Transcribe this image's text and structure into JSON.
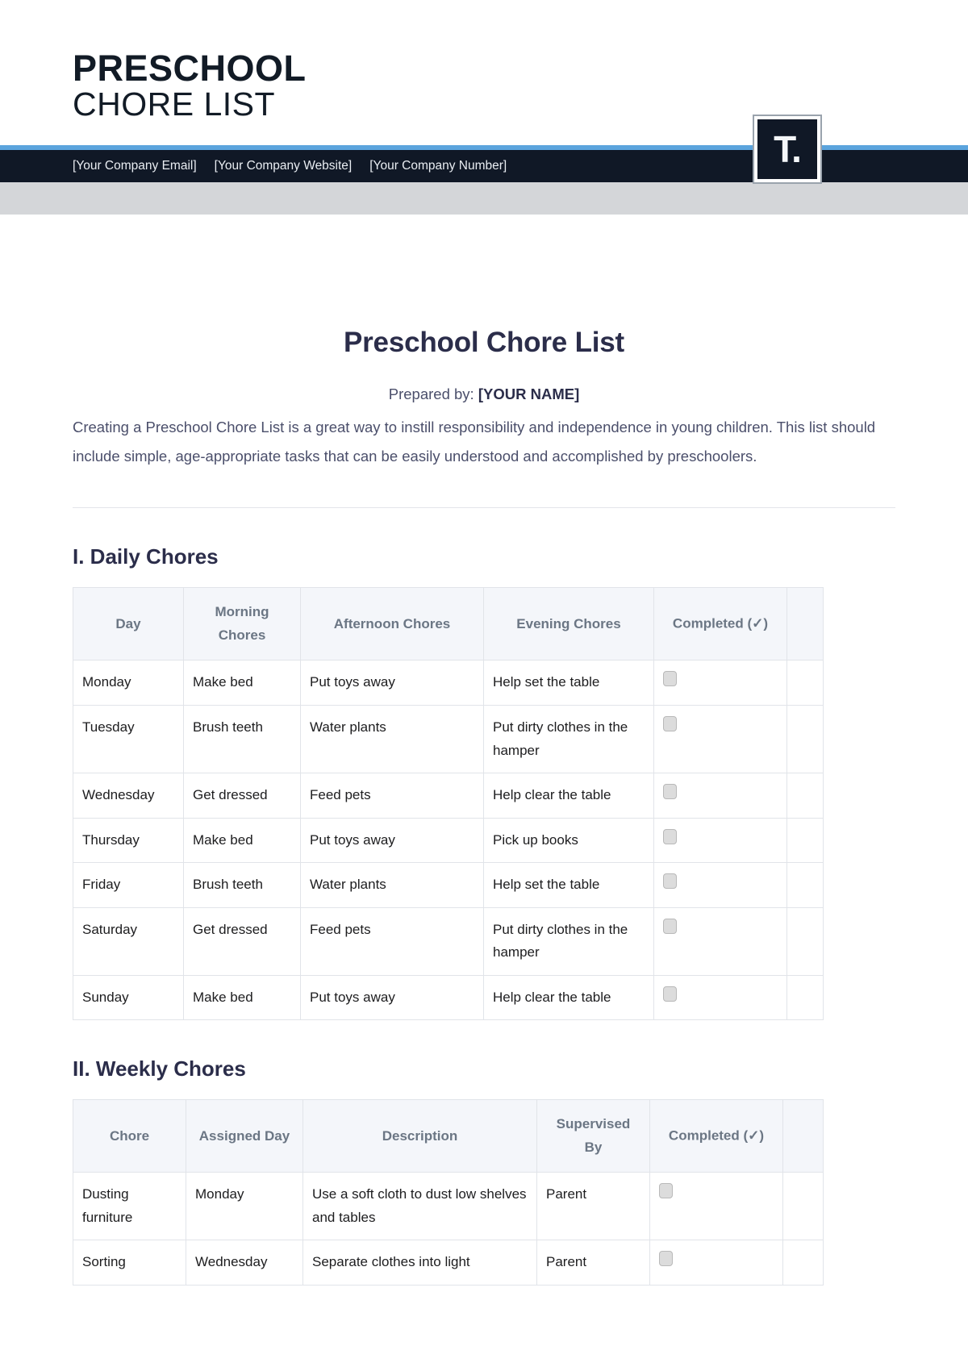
{
  "letterhead": {
    "brand_line1": "PRESCHOOL",
    "brand_line2": "CHORE LIST",
    "logo_glyph": "T.",
    "contacts": [
      "[Your Company Email]",
      "[Your Company Website]",
      "[Your Company Number]"
    ],
    "accent_blue": "#5ba4dd",
    "bar_dark": "#101826",
    "band_gray": "#d4d6d9"
  },
  "document": {
    "title": "Preschool Chore List",
    "prepared_label": "Prepared by:",
    "prepared_name": "[YOUR NAME]",
    "intro": "Creating a Preschool Chore List is a great way to instill responsibility and independence in young children. This list should include simple, age-appropriate tasks that can be easily understood and accomplished by preschoolers."
  },
  "sections": [
    {
      "heading": "I. Daily Chores",
      "columns": [
        "Day",
        "Morning Chores",
        "Afternoon Chores",
        "Evening Chores",
        "Completed (✓)",
        ""
      ],
      "rows": [
        [
          "Monday",
          "Make bed",
          "Put toys away",
          "Help set the table",
          "",
          ""
        ],
        [
          "Tuesday",
          "Brush teeth",
          "Water plants",
          "Put dirty clothes in the hamper",
          "",
          ""
        ],
        [
          "Wednesday",
          "Get dressed",
          "Feed pets",
          "Help clear the table",
          "",
          ""
        ],
        [
          "Thursday",
          "Make bed",
          "Put toys away",
          "Pick up books",
          "",
          ""
        ],
        [
          "Friday",
          "Brush teeth",
          "Water plants",
          "Help set the table",
          "",
          ""
        ],
        [
          "Saturday",
          "Get dressed",
          "Feed pets",
          "Put dirty clothes in the hamper",
          "",
          ""
        ],
        [
          "Sunday",
          "Make bed",
          "Put toys away",
          "Help clear the table",
          "",
          ""
        ]
      ]
    },
    {
      "heading": "II. Weekly Chores",
      "columns": [
        "Chore",
        "Assigned Day",
        "Description",
        "Supervised By",
        "Completed (✓)",
        ""
      ],
      "rows": [
        [
          "Dusting furniture",
          "Monday",
          "Use a soft cloth to dust low shelves and tables",
          "Parent",
          "",
          ""
        ],
        [
          "Sorting",
          "Wednesday",
          "Separate clothes into light",
          "Parent",
          "",
          ""
        ]
      ]
    }
  ]
}
